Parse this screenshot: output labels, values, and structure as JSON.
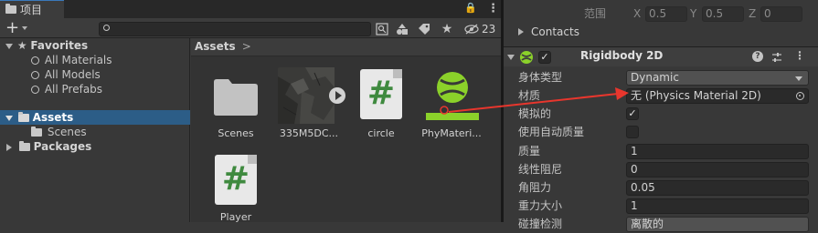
{
  "project": {
    "tab_title": "项目",
    "add_label": "+",
    "lock_glyph": "🔒",
    "more_glyph": "⋮",
    "menu_glyph": "⋮",
    "hidden_count": "23",
    "sidebar": {
      "favorites": {
        "label": "Favorites",
        "items": [
          "All Materials",
          "All Models",
          "All Prefabs"
        ]
      },
      "assets": {
        "label": "Assets",
        "children": [
          "Scenes"
        ]
      },
      "packages": {
        "label": "Packages"
      }
    },
    "breadcrumb": "Assets",
    "breadcrumb_sep": ">",
    "assets": [
      {
        "label": "Scenes",
        "icon": "folder-icon"
      },
      {
        "label": "335M5DC...",
        "icon": "texture-icon"
      },
      {
        "label": "circle",
        "icon": "script-icon"
      },
      {
        "label": "PhyMateri...",
        "icon": "physics-material-icon"
      },
      {
        "label": "Player",
        "icon": "script-icon"
      }
    ],
    "script_glyph": "#"
  },
  "inspector": {
    "range_row": {
      "label": "范围",
      "x_label": "X",
      "x_value": "0.5",
      "y_label": "Y",
      "y_value": "0.5",
      "z_label": "Z",
      "z_value": "0"
    },
    "contacts_label": "Contacts",
    "component": {
      "title": "Rigidbody 2D",
      "enabled": true,
      "help_glyph": "?",
      "menu_glyph": "⋮"
    },
    "properties": [
      {
        "label": "身体类型",
        "value": "Dynamic",
        "kind": "dropdown"
      },
      {
        "label": "材质",
        "value": "无 (Physics Material 2D)",
        "kind": "object"
      },
      {
        "label": "模拟的",
        "value": "✓",
        "kind": "checkbox"
      },
      {
        "label": "使用自动质量",
        "value": "",
        "kind": "checkbox"
      },
      {
        "label": "质量",
        "value": "1",
        "kind": "number"
      },
      {
        "label": "线性阻尼",
        "value": "0",
        "kind": "number"
      },
      {
        "label": "角阻力",
        "value": "0.05",
        "kind": "number"
      },
      {
        "label": "重力大小",
        "value": "1",
        "kind": "number"
      },
      {
        "label": "碰撞检测",
        "value": "离散的",
        "kind": "dropdown"
      }
    ]
  },
  "colors": {
    "accent": "#2c5d87",
    "script_green": "#3f8a3f",
    "physics_green": "#8bd12a",
    "arrow_red": "#e8362d"
  }
}
